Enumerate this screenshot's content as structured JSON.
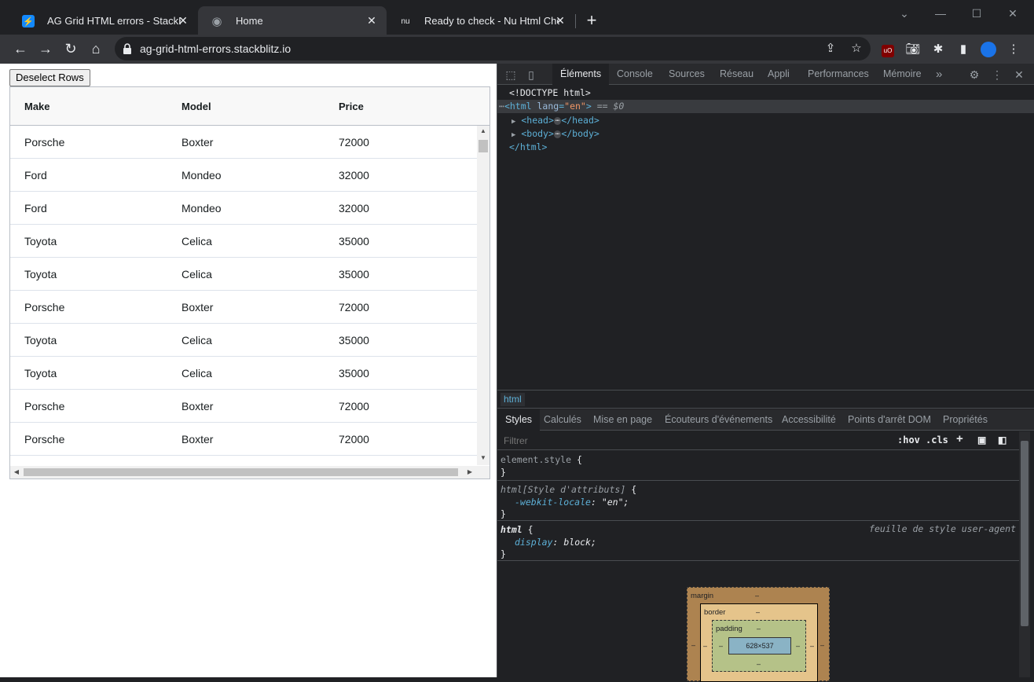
{
  "browser": {
    "tabs": [
      {
        "title": "AG Grid HTML errors - StackBlitz",
        "favicon": "⚡"
      },
      {
        "title": "Home",
        "favicon": "◉"
      },
      {
        "title": "Ready to check - Nu Html Checker",
        "favicon": "nu"
      }
    ],
    "new_tab": "+",
    "url": "ag-grid-html-errors.stackblitz.io"
  },
  "page": {
    "deselect_button": "Deselect Rows",
    "grid": {
      "columns": [
        "Make",
        "Model",
        "Price"
      ],
      "rows": [
        [
          "Porsche",
          "Boxter",
          "72000"
        ],
        [
          "Ford",
          "Mondeo",
          "32000"
        ],
        [
          "Ford",
          "Mondeo",
          "32000"
        ],
        [
          "Toyota",
          "Celica",
          "35000"
        ],
        [
          "Toyota",
          "Celica",
          "35000"
        ],
        [
          "Porsche",
          "Boxter",
          "72000"
        ],
        [
          "Toyota",
          "Celica",
          "35000"
        ],
        [
          "Toyota",
          "Celica",
          "35000"
        ],
        [
          "Porsche",
          "Boxter",
          "72000"
        ],
        [
          "Porsche",
          "Boxter",
          "72000"
        ]
      ]
    }
  },
  "devtools": {
    "tabs": [
      "Éléments",
      "Console",
      "Sources",
      "Réseau",
      "Appli",
      "Performances",
      "Mémoire"
    ],
    "more_tabs": "»",
    "dom": {
      "doctype": "<!DOCTYPE html>",
      "html_open_tag": "<html",
      "lang_attr": "lang",
      "lang_val": "\"en\"",
      "html_close_bracket": ">",
      "selected_marker": "== $0",
      "head_open": "<head>",
      "head_close": "</head>",
      "body_open": "<body>",
      "body_close": "</body>",
      "html_close": "</html>",
      "ellipsis": "⋯"
    },
    "breadcrumb": "html",
    "sub_tabs": [
      "Styles",
      "Calculés",
      "Mise en page",
      "Écouteurs d'événements",
      "Accessibilité",
      "Points d'arrêt DOM",
      "Propriétés"
    ],
    "filter_placeholder": "Filtrer",
    "hov": ":hov",
    "cls": ".cls",
    "rules": {
      "element_style": "element.style",
      "open_brace": "{",
      "close_brace": "}",
      "attr_selector": "html[Style d'attributs]",
      "attr_prop": "-webkit-locale",
      "attr_val": "\"en\";",
      "ua_selector": "html",
      "ua_source": "feuille de style user-agent",
      "ua_prop": "display",
      "ua_val": "block;",
      "colon": ":"
    },
    "box_model": {
      "margin": "margin",
      "border": "border",
      "padding": "padding",
      "content": "628×537",
      "dash": "–"
    }
  }
}
